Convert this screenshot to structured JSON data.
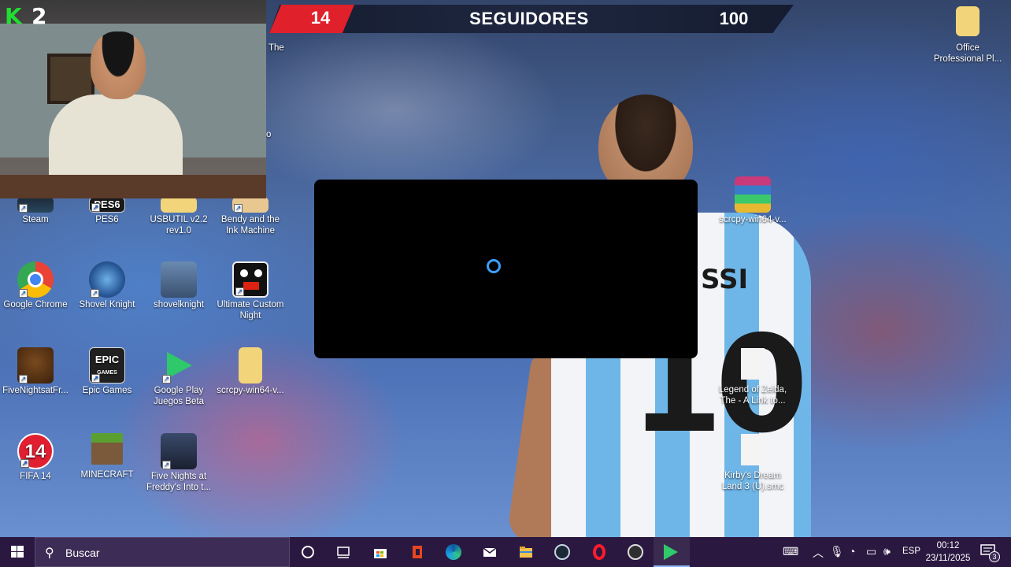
{
  "stream_overlay": {
    "banner": {
      "left_value": "14",
      "title": "SEGUIDORES",
      "right_value": "100"
    },
    "webcam": {
      "logo_letter": "K",
      "count": "2"
    }
  },
  "desktop": {
    "icons": [
      {
        "name": "Steam",
        "icon": "steam-icon"
      },
      {
        "name": "PES6",
        "icon": "pes6-icon"
      },
      {
        "name": "USBUTIL v2.2 rev1.0",
        "icon": "folder-icon"
      },
      {
        "name": "Bendy and the Ink Machine",
        "icon": "bendy-icon"
      },
      {
        "name": "Google Chrome",
        "icon": "chrome-icon"
      },
      {
        "name": "Shovel Knight",
        "icon": "shovel-knight-icon"
      },
      {
        "name": "shovelknight",
        "icon": "shovel-knight-folder-icon"
      },
      {
        "name": "Ultimate Custom Night",
        "icon": "ucn-icon"
      },
      {
        "name": "FiveNightsatFr...",
        "icon": "freddy-icon"
      },
      {
        "name": "Epic Games",
        "icon": "epic-games-icon"
      },
      {
        "name": "Google Play Juegos Beta",
        "icon": "google-play-games-icon"
      },
      {
        "name": "scrcpy-win64-v...",
        "icon": "folder-icon"
      },
      {
        "name": "FIFA 14",
        "icon": "fifa-icon"
      },
      {
        "name": "MINECRAFT",
        "icon": "minecraft-icon"
      },
      {
        "name": "Five Nights at Freddy's Into t...",
        "icon": "fnaf-icon"
      },
      {
        "name": "Office Professional Pl...",
        "icon": "folder-icon"
      },
      {
        "name": "scrcpy-win64-v...",
        "icon": "winrar-icon"
      },
      {
        "name": "Legend of Zelda, The - A Link to...",
        "icon": "file-icon"
      },
      {
        "name": "Kirby's Dream Land 3 (U).smc",
        "icon": "file-icon"
      }
    ],
    "partial_label_top": "The",
    "partial_label_mid": "o",
    "wallpaper": {
      "jersey_number": "10",
      "jersey_name": "SSI"
    }
  },
  "taskbar": {
    "search_placeholder": "Buscar",
    "pinned": [
      "cortana-icon",
      "task-view-icon",
      "store-icon",
      "office-icon",
      "edge-icon",
      "mail-icon",
      "file-explorer-icon",
      "steam-icon",
      "opera-icon",
      "obs-icon",
      "google-play-games-icon"
    ],
    "language": "ESP",
    "time": "00:12",
    "date": "23/11/2025",
    "notification_count": "3"
  },
  "colors": {
    "taskbar": "#2a1840",
    "banner_red": "#e0202a",
    "spinner": "#3aa0ff"
  }
}
